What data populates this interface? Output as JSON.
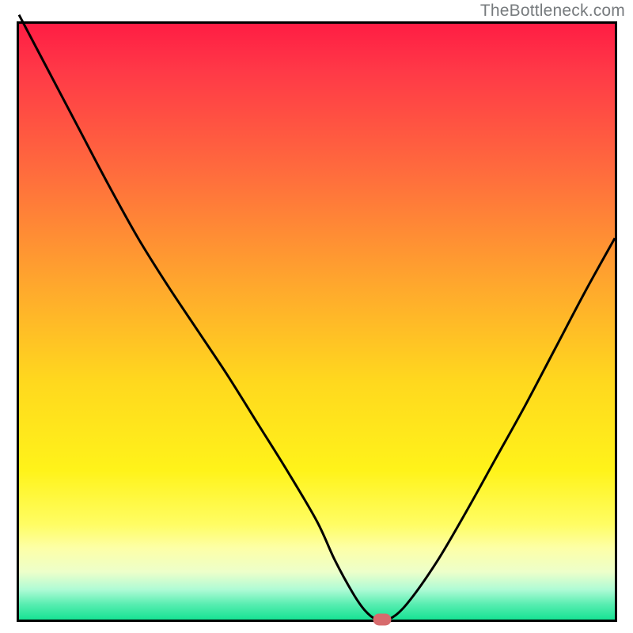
{
  "watermark": "TheBottleneck.com",
  "colors": {
    "gradient_top": "#ff1d44",
    "gradient_bottom": "#17e294",
    "curve": "#000000",
    "marker": "#d76b6d",
    "border": "#000000"
  },
  "chart_data": {
    "type": "line",
    "title": "",
    "xlabel": "",
    "ylabel": "",
    "xlim": [
      0,
      100
    ],
    "ylim": [
      0,
      100
    ],
    "x": [
      0,
      5,
      10,
      15,
      20,
      25,
      30,
      35,
      40,
      45,
      50,
      53,
      56,
      58,
      60,
      62,
      65,
      70,
      75,
      80,
      85,
      90,
      95,
      100
    ],
    "values": [
      101.5,
      92,
      82.5,
      73,
      64,
      56,
      48.5,
      41,
      33,
      25,
      16.5,
      10,
      4.5,
      1.6,
      0,
      0,
      2.5,
      9.5,
      18,
      27,
      36,
      45.5,
      55,
      64
    ],
    "series": [
      {
        "name": "bottleneck-curve",
        "x": [
          0,
          5,
          10,
          15,
          20,
          25,
          30,
          35,
          40,
          45,
          50,
          53,
          56,
          58,
          60,
          62,
          65,
          70,
          75,
          80,
          85,
          90,
          95,
          100
        ],
        "values": [
          101.5,
          92,
          82.5,
          73,
          64,
          56,
          48.5,
          41,
          33,
          25,
          16.5,
          10,
          4.5,
          1.6,
          0,
          0,
          2.5,
          9.5,
          18,
          27,
          36,
          45.5,
          55,
          64
        ]
      }
    ],
    "marker": {
      "x": 61,
      "y": 0
    },
    "grid": false,
    "legend": false,
    "background": "red-yellow-green vertical gradient"
  }
}
